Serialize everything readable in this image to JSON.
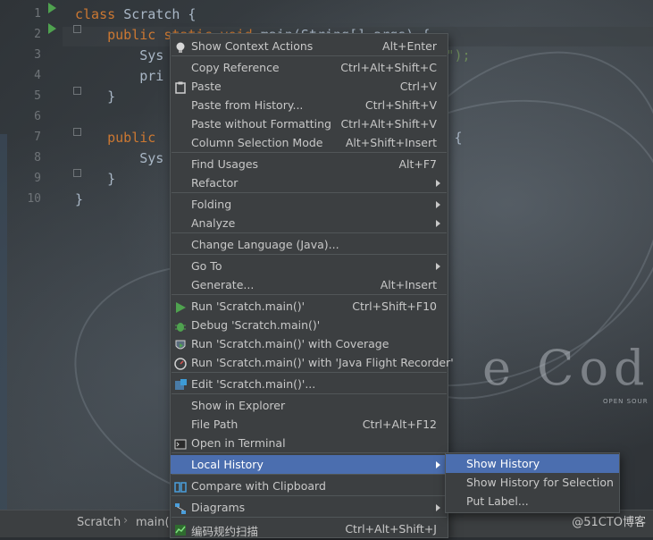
{
  "editor": {
    "line_numbers": [
      "1",
      "2",
      "3",
      "4",
      "5",
      "6",
      "7",
      "8",
      "9",
      "10"
    ],
    "code_lines": [
      {
        "parts": [
          {
            "k": "kw",
            "t": "class "
          },
          {
            "k": "tx",
            "t": "Scratch {"
          }
        ]
      },
      {
        "parts": [
          {
            "k": "kw",
            "t": "    public static void "
          },
          {
            "k": "tx",
            "t": "main(String[] args) {"
          }
        ]
      },
      {
        "parts": [
          {
            "k": "tx",
            "t": "        Sys"
          },
          {
            "k": "tx",
            "t": "                            "
          },
          {
            "k": "str",
            "t": "s files\");"
          }
        ]
      },
      {
        "parts": [
          {
            "k": "tx",
            "t": "        pri"
          }
        ]
      },
      {
        "parts": [
          {
            "k": "tx",
            "t": "    }"
          }
        ]
      },
      {
        "parts": [
          {
            "k": "tx",
            "t": ""
          }
        ]
      },
      {
        "parts": [
          {
            "k": "kw",
            "t": "    public "
          },
          {
            "k": "tx",
            "t": "                                e)  {"
          }
        ]
      },
      {
        "parts": [
          {
            "k": "tx",
            "t": "        Sys"
          }
        ]
      },
      {
        "parts": [
          {
            "k": "tx",
            "t": "    }"
          }
        ]
      },
      {
        "parts": [
          {
            "k": "tx",
            "t": "}"
          }
        ]
      }
    ],
    "watermark": "e Cod",
    "watermark_sub": "OPEN SOUR"
  },
  "statusbar": {
    "crumb1": "Scratch",
    "crumb2": "main()"
  },
  "brand": "@51CTO博客",
  "context_menu": {
    "items": [
      {
        "label": "Show Context Actions",
        "shortcut": "Alt+Enter",
        "icon": "bulb-icon"
      },
      {
        "label": "Copy Reference",
        "shortcut": "Ctrl+Alt+Shift+C"
      },
      {
        "label": "Paste",
        "shortcut": "Ctrl+V",
        "icon": "clipboard-icon"
      },
      {
        "label": "Paste from History...",
        "shortcut": "Ctrl+Shift+V"
      },
      {
        "label": "Paste without Formatting",
        "shortcut": "Ctrl+Alt+Shift+V"
      },
      {
        "label": "Column Selection Mode",
        "shortcut": "Alt+Shift+Insert"
      },
      {
        "label": "Find Usages",
        "shortcut": "Alt+F7"
      },
      {
        "label": "Refactor",
        "submenu": true
      },
      {
        "label": "Folding",
        "submenu": true
      },
      {
        "label": "Analyze",
        "submenu": true
      },
      {
        "label": "Change Language (Java)..."
      },
      {
        "label": "Go To",
        "submenu": true
      },
      {
        "label": "Generate...",
        "shortcut": "Alt+Insert"
      },
      {
        "label": "Run 'Scratch.main()'",
        "shortcut": "Ctrl+Shift+F10",
        "icon": "run-icon"
      },
      {
        "label": "Debug 'Scratch.main()'",
        "icon": "debug-icon"
      },
      {
        "label": "Run 'Scratch.main()' with Coverage",
        "icon": "coverage-icon"
      },
      {
        "label": "Run 'Scratch.main()' with 'Java Flight Recorder'",
        "icon": "profiler-icon"
      },
      {
        "label": "Edit 'Scratch.main()'...",
        "icon": "edit-config-icon"
      },
      {
        "label": "Show in Explorer"
      },
      {
        "label": "File Path",
        "shortcut": "Ctrl+Alt+F12"
      },
      {
        "label": "Open in Terminal",
        "icon": "terminal-icon"
      },
      {
        "label": "Local History",
        "submenu": true,
        "selected": true
      },
      {
        "label": "Compare with Clipboard",
        "icon": "compare-icon"
      },
      {
        "label": "Diagrams",
        "submenu": true,
        "icon": "diagram-icon"
      },
      {
        "label": "编码规约扫描",
        "shortcut": "Ctrl+Alt+Shift+J",
        "icon": "scan-icon"
      }
    ]
  },
  "submenu": {
    "items": [
      {
        "label": "Show History",
        "selected": true
      },
      {
        "label": "Show History for Selection"
      },
      {
        "label": "Put Label..."
      }
    ]
  },
  "colors": {
    "menu_bg": "#3c3f41",
    "selection": "#4b6eaf",
    "keyword": "#cc7832",
    "string": "#6a8759",
    "run_green": "#4fa24f"
  }
}
